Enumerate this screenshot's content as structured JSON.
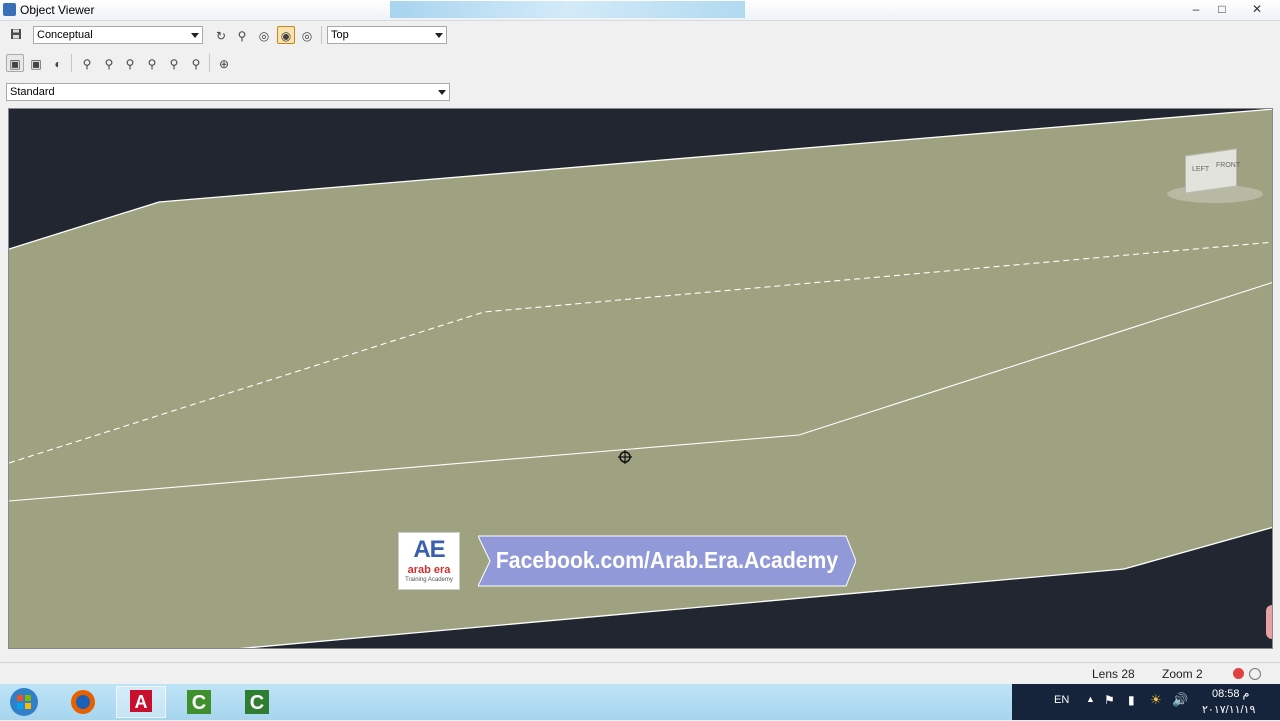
{
  "window": {
    "title": "Object Viewer"
  },
  "toolbar1": {
    "visual_style": "Conceptual",
    "view": "Top"
  },
  "toolbar3": {
    "ucs": "Standard"
  },
  "viewcube": {
    "left_label": "LEFT",
    "front_label": "FRONT"
  },
  "banner": {
    "text": "Facebook.com/Arab.Era.Academy"
  },
  "logo": {
    "main": "AE",
    "line1": "arab era",
    "line2": "Training Academy"
  },
  "status": {
    "lens": "Lens 28",
    "zoom": "Zoom 2"
  },
  "tray": {
    "language": "EN",
    "time": "08:58 م",
    "date": "٢٠١٧/١١/١٩"
  },
  "colors": {
    "surface": "#9fa280",
    "background": "#212631",
    "banner": "#9299d8"
  }
}
